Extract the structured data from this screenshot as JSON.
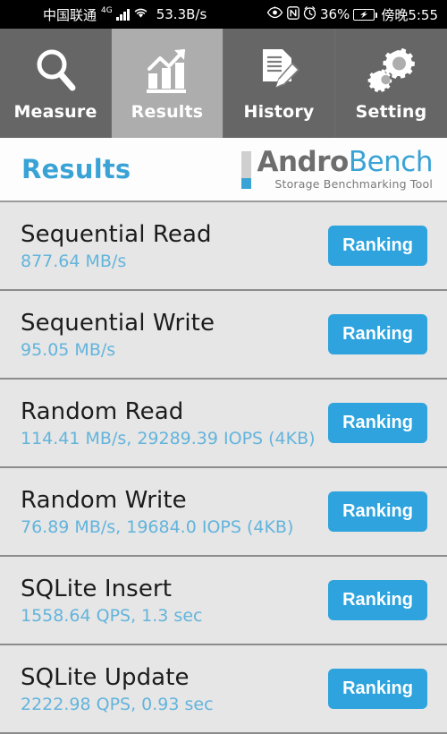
{
  "statusbar": {
    "carrier": "中国联通",
    "network_gen": "4G",
    "signal_icon": "signal-bars-icon",
    "wifi_icon": "wifi-icon",
    "network_speed": "53.3B/s",
    "eye_icon": "eye-icon",
    "nfc_icon": "nfc-icon",
    "alarm_icon": "alarm-clock-icon",
    "battery_percent": "36%",
    "battery_icon": "battery-charging-icon",
    "time": "傍晚5:55"
  },
  "tabs": [
    {
      "label": "Measure",
      "icon": "magnifier-icon",
      "active": false
    },
    {
      "label": "Results",
      "icon": "bar-chart-arrow-icon",
      "active": true
    },
    {
      "label": "History",
      "icon": "document-pencil-icon",
      "active": false
    },
    {
      "label": "Setting",
      "icon": "gears-icon",
      "active": false
    }
  ],
  "header": {
    "page_title": "Results",
    "logo_primary": "Andro",
    "logo_secondary": "Bench",
    "logo_tagline": "Storage Benchmarking Tool"
  },
  "results": [
    {
      "title": "Sequential Read",
      "value": "877.64 MB/s",
      "button": "Ranking"
    },
    {
      "title": "Sequential Write",
      "value": "95.05 MB/s",
      "button": "Ranking"
    },
    {
      "title": "Random Read",
      "value": "114.41 MB/s, 29289.39 IOPS (4KB)",
      "button": "Ranking"
    },
    {
      "title": "Random Write",
      "value": "76.89 MB/s, 19684.0 IOPS (4KB)",
      "button": "Ranking"
    },
    {
      "title": "SQLite Insert",
      "value": "1558.64 QPS, 1.3 sec",
      "button": "Ranking"
    },
    {
      "title": "SQLite Update",
      "value": "2222.98 QPS, 0.93 sec",
      "button": "Ranking"
    }
  ],
  "colors": {
    "accent_blue": "#2ea3dd",
    "value_blue": "#63b4dc",
    "tab_bg": "#666666",
    "tab_active_bg": "#adadad",
    "list_bg": "#e6e6e6"
  }
}
